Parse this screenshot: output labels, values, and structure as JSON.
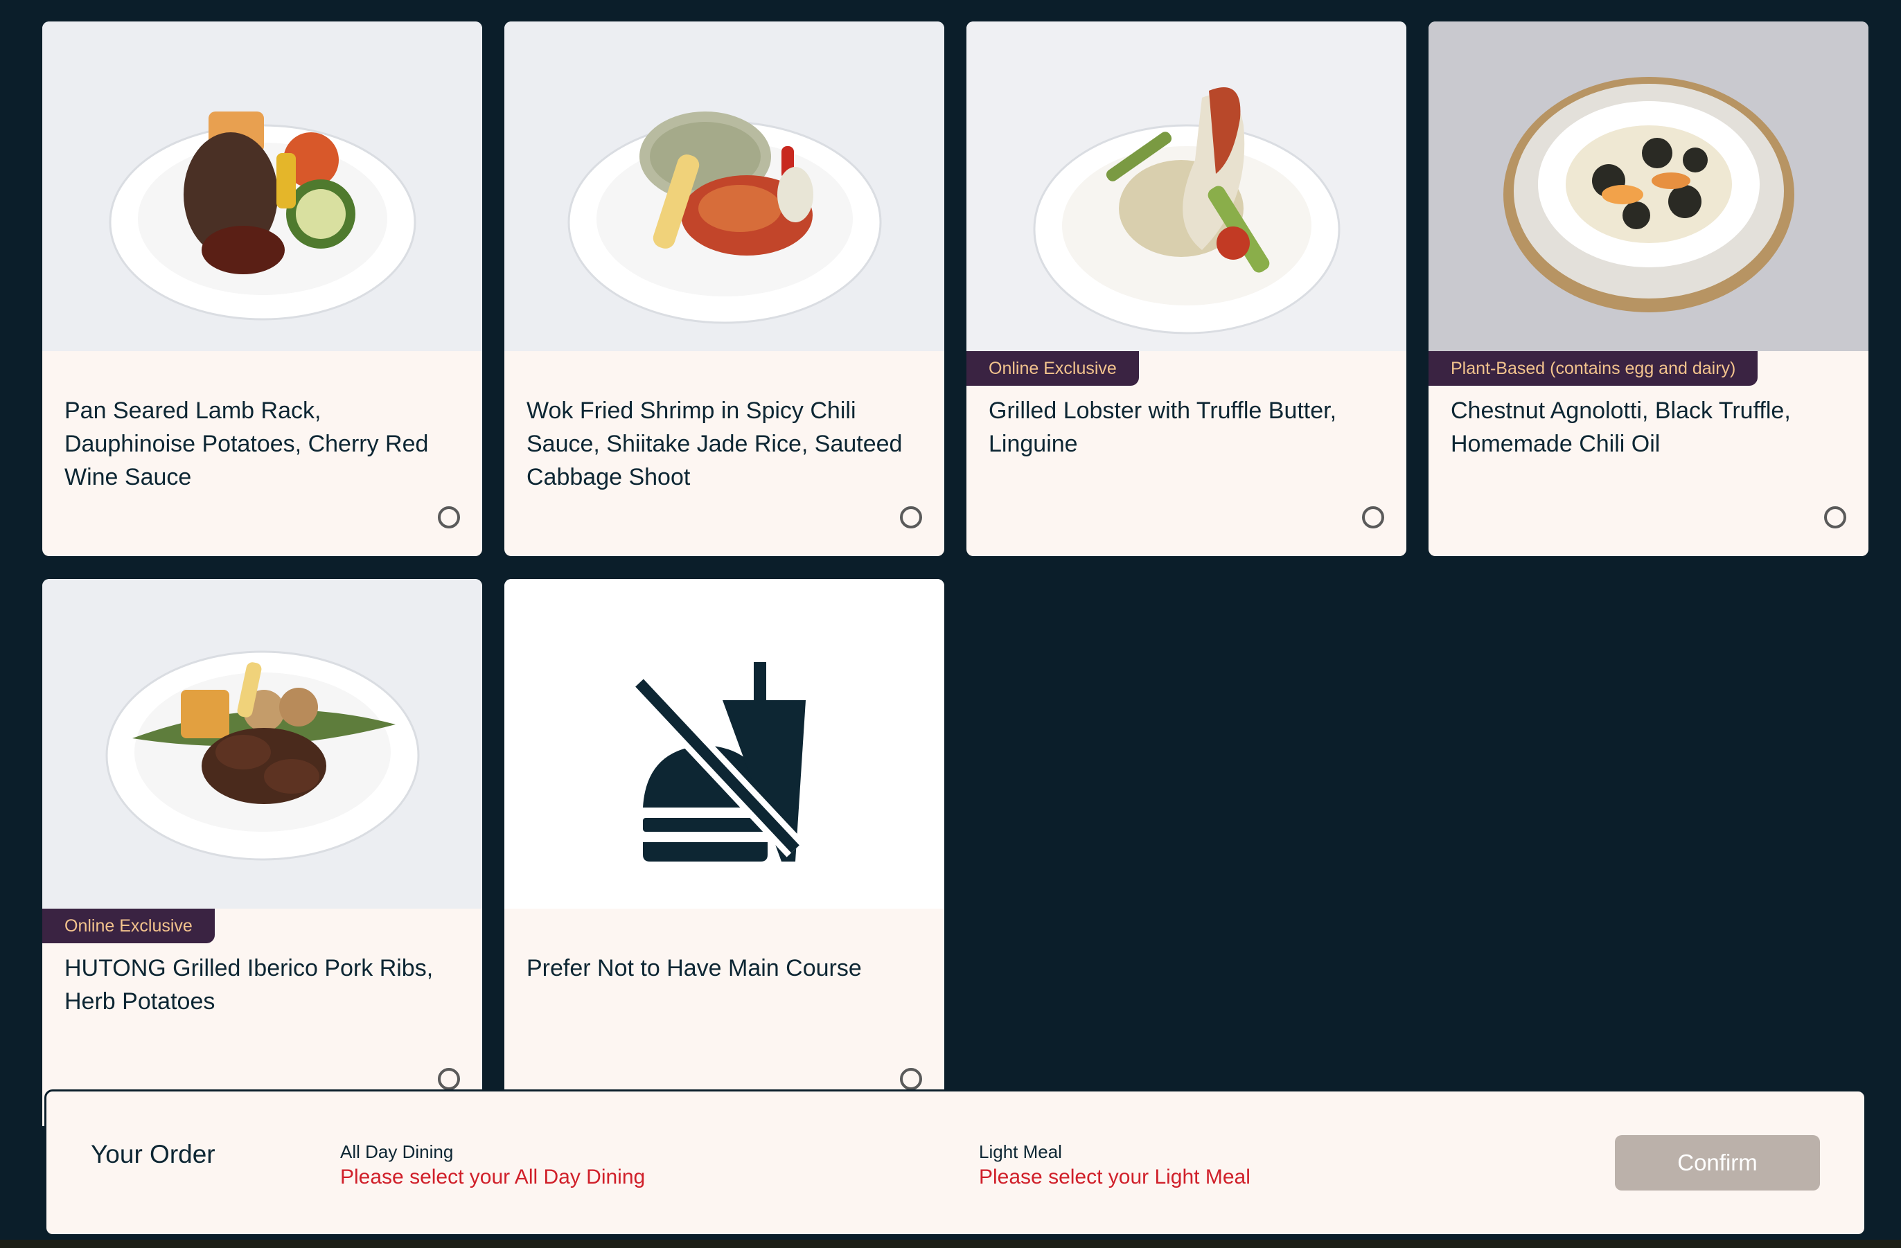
{
  "dishes": [
    {
      "title": "Pan Seared Lamb Rack, Dauphinoise Potatoes, Cherry Red Wine Sauce",
      "badge": ""
    },
    {
      "title": "Wok Fried Shrimp in Spicy Chili Sauce, Shiitake Jade Rice, Sauteed Cabbage Shoot",
      "badge": ""
    },
    {
      "title": "Grilled Lobster with Truffle Butter, Linguine",
      "badge": "Online Exclusive"
    },
    {
      "title": "Chestnut Agnolotti, Black Truffle, Homemade Chili Oil",
      "badge": "Plant-Based (contains egg and dairy)"
    },
    {
      "title": "HUTONG Grilled Iberico Pork Ribs, Herb Potatoes",
      "badge": "Online Exclusive"
    },
    {
      "title": "Prefer Not to Have Main Course",
      "badge": ""
    }
  ],
  "order": {
    "title": "Your Order",
    "categories": [
      {
        "label": "All Day Dining",
        "value": "Please select your All Day Dining"
      },
      {
        "label": "Light Meal",
        "value": "Please select your Light Meal"
      }
    ],
    "confirm_label": "Confirm"
  },
  "colors": {
    "background": "#0b1e2a",
    "card": "#fdf6f2",
    "badge_bg": "#3a2342",
    "badge_text": "#f2c38d",
    "error": "#d0202a",
    "confirm_disabled": "#bbb1aa"
  }
}
